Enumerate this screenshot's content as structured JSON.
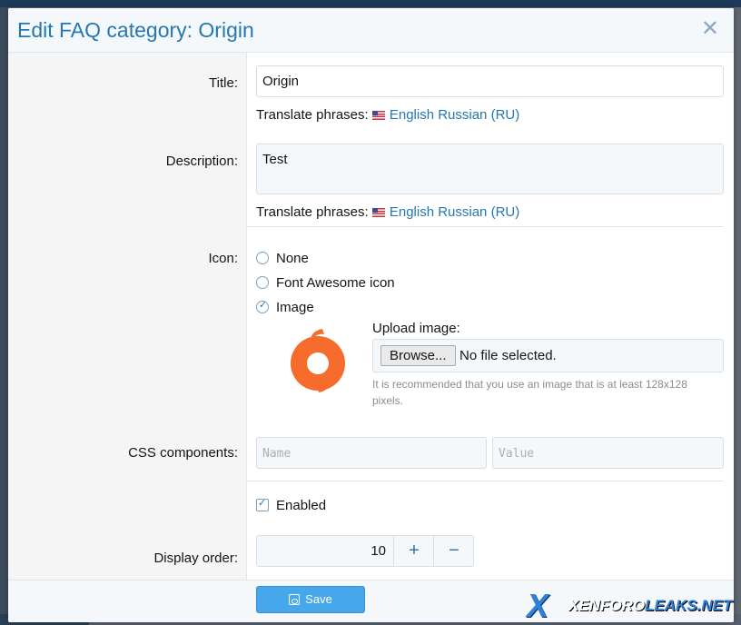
{
  "dialog": {
    "title": "Edit FAQ category: Origin",
    "close_icon": "close-icon"
  },
  "form": {
    "title": {
      "label": "Title:",
      "value": "Origin"
    },
    "title_translate": {
      "prefix": "Translate phrases:",
      "flag": "us-flag-icon",
      "link": "English Russian (RU)"
    },
    "description": {
      "label": "Description:",
      "value": "Test"
    },
    "description_translate": {
      "prefix": "Translate phrases:",
      "flag": "us-flag-icon",
      "link": "English Russian (RU)"
    },
    "icon": {
      "label": "Icon:",
      "options": [
        {
          "label": "None",
          "selected": false
        },
        {
          "label": "Font Awesome icon",
          "selected": false
        },
        {
          "label": "Image",
          "selected": true
        }
      ],
      "upload_label": "Upload image:",
      "browse_label": "Browse...",
      "file_status": "No file selected.",
      "hint": "It is recommended that you use an image that is at least 128x128 pixels.",
      "preview": "origin-logo",
      "preview_color": "#f56c2d"
    },
    "css": {
      "label": "CSS components:",
      "name_placeholder": "Name",
      "value_placeholder": "Value"
    },
    "enabled": {
      "label": "Enabled",
      "checked": true
    },
    "display_order": {
      "label": "Display order:",
      "value": "10",
      "plus": "+",
      "minus": "−"
    }
  },
  "footer": {
    "save_label": "Save",
    "save_icon": "save-icon"
  },
  "watermark": {
    "x": "X",
    "brand": "XENFORO",
    "suffix": "LEAKS.NET"
  },
  "colors": {
    "accent": "#2577b1",
    "button": "#47a7eb"
  }
}
